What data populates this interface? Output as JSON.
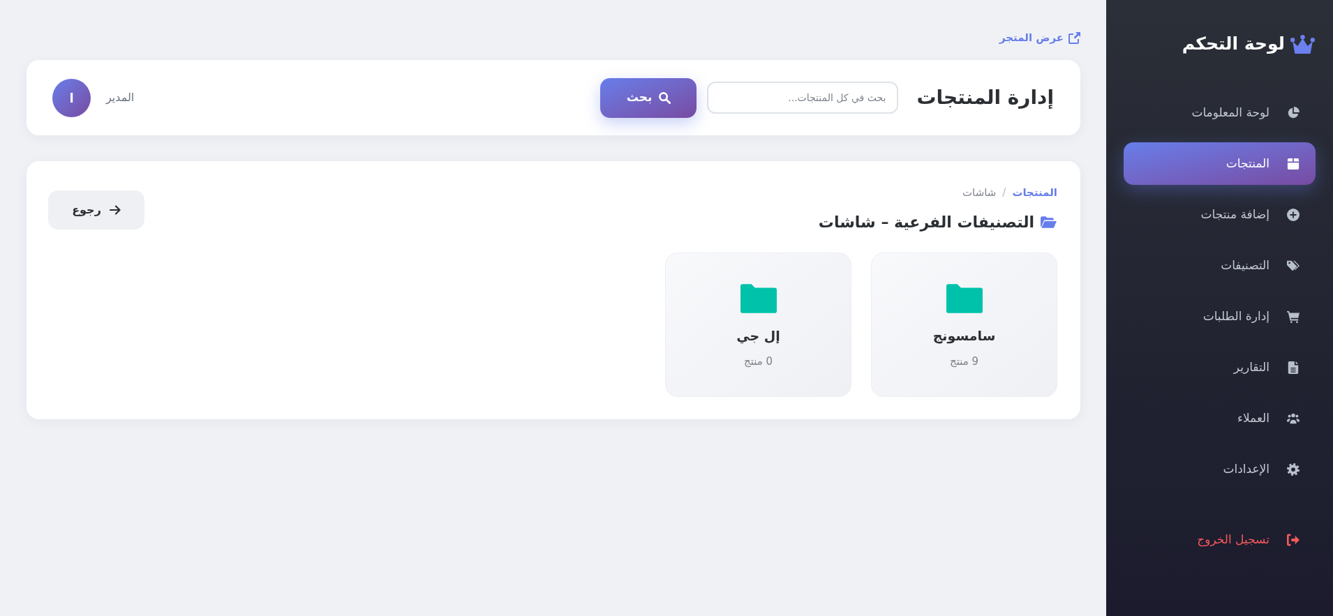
{
  "sidebar": {
    "title": "لوحة التحكم",
    "items": [
      {
        "label": "لوحة المعلومات",
        "selected": false
      },
      {
        "label": "المنتجات",
        "selected": true
      },
      {
        "label": "إضافة منتجات",
        "selected": false
      },
      {
        "label": "التصنيفات",
        "selected": false
      },
      {
        "label": "إدارة الطلبات",
        "selected": false
      },
      {
        "label": "التقارير",
        "selected": false
      },
      {
        "label": "العملاء",
        "selected": false
      },
      {
        "label": "الإعدادات",
        "selected": false
      }
    ],
    "logout": "تسجيل الخروج"
  },
  "store_link": "عرض المتجر",
  "header": {
    "title": "إدارة المنتجات",
    "search": {
      "placeholder": "بحث في كل المنتجات...",
      "button": "بحث"
    },
    "user": {
      "name": "المدير",
      "initial": "ا"
    }
  },
  "content": {
    "breadcrumb": {
      "items": [
        {
          "label": "المنتجات",
          "kind": "link"
        },
        {
          "label": "شاشات",
          "kind": "current"
        }
      ],
      "separator": "/"
    },
    "heading": "التصنيفات الفرعية – شاشات",
    "back_button": "رجوع",
    "subcategories": [
      {
        "name": "سامسونج",
        "count": "9 منتج"
      },
      {
        "name": "إل جي",
        "count": "0 منتج"
      }
    ]
  }
}
